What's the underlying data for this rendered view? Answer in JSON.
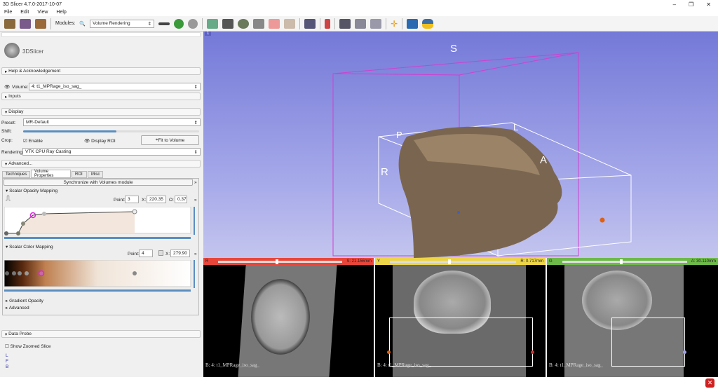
{
  "window": {
    "title": "3D Slicer 4.7.0-2017-10-07"
  },
  "menu": [
    "File",
    "Edit",
    "View",
    "Help"
  ],
  "toolbar": {
    "modules_label": "Modules:",
    "module": "Volume Rendering"
  },
  "logo": "3DSlicer",
  "panel": {
    "help": "Help & Acknowledgement",
    "volume_label": "Volume:",
    "volume": "4: t1_MPRage_iso_sag_",
    "inputs": "Inputs",
    "display": "Display",
    "preset_label": "Preset:",
    "preset": "MR-Default",
    "shift_label": "Shift:",
    "shift_value": 0.53,
    "crop_label": "Crop:",
    "enable": "Enable",
    "enable_checked": true,
    "display_roi": "Display ROI",
    "fit": "Fit to Volume",
    "rendering_label": "Rendering:",
    "rendering": "VTK CPU Ray Casting",
    "advanced": "Advanced...",
    "tabs": [
      "Techniques",
      "Volume Properties",
      "ROI",
      "Misc"
    ],
    "active_tab": "Volume Properties",
    "sync": "Synchronize with Volumes module",
    "opacity": {
      "title": "Scalar Opacity Mapping",
      "point_label": "Point:",
      "point": "3",
      "x_label": "X:",
      "x": "220.35",
      "o_label": "O:",
      "o": "0.37"
    },
    "color": {
      "title": "Scalar Color Mapping",
      "point_label": "Point:",
      "point": "4",
      "x_label": "X:",
      "x": "279.90"
    },
    "gradient": "Gradient Opacity",
    "advanced2": "Advanced",
    "probe": "Data Probe",
    "zoomed": "Show Zoomed Slice",
    "probe_lines": [
      "L",
      "F",
      "B"
    ]
  },
  "view3d": {
    "labels": {
      "S": "S",
      "L": "L",
      "P": "P",
      "A": "A",
      "R": "R"
    },
    "view_number": "1"
  },
  "slices": [
    {
      "id": "R",
      "color": "#e8463a",
      "value": "S: 21.156mm",
      "caption": "B: 4: t1_MPRage_iso_sag_"
    },
    {
      "id": "Y",
      "color": "#edd54a",
      "value": "R: 0.717mm",
      "caption": "B: 4: t1_MPRage_iso_sag_"
    },
    {
      "id": "G",
      "color": "#6dba4a",
      "value": "A: 30.110mm",
      "caption": "B: 4: t1_MPRage_iso_sag_"
    }
  ]
}
